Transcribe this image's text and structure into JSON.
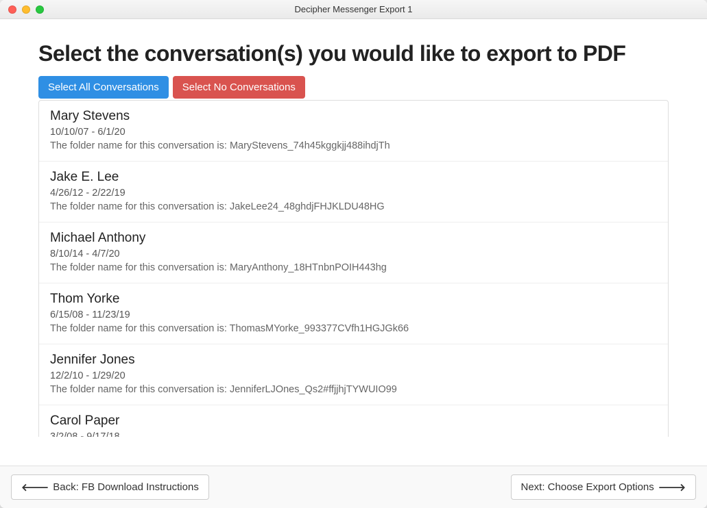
{
  "window": {
    "title": "Decipher Messenger Export 1"
  },
  "page": {
    "heading": "Select the conversation(s) you would like to export to PDF"
  },
  "buttons": {
    "select_all": "Select All Conversations",
    "select_none": "Select No Conversations"
  },
  "folder_label_prefix": "The folder name for this conversation is: ",
  "conversations": [
    {
      "name": "Mary Stevens",
      "dates": "10/10/07 - 6/1/20",
      "folder": "MaryStevens_74h45kggkjj488ihdjTh"
    },
    {
      "name": "Jake E. Lee",
      "dates": "4/26/12 - 2/22/19",
      "folder": "JakeLee24_48ghdjFHJKLDU48HG"
    },
    {
      "name": "Michael Anthony",
      "dates": "8/10/14 - 4/7/20",
      "folder": "MaryAnthony_18HTnbnPOIH443hg"
    },
    {
      "name": "Thom Yorke",
      "dates": "6/15/08 - 11/23/19",
      "folder": "ThomasMYorke_993377CVfh1HGJGk66"
    },
    {
      "name": "Jennifer Jones",
      "dates": "12/2/10 - 1/29/20",
      "folder": "JenniferLJOnes_Qs2#ffjjhjTYWUIO99"
    },
    {
      "name": "Carol Paper",
      "dates": "3/2/08 - 9/17/18",
      "folder": ""
    }
  ],
  "footer": {
    "back_label": "Back: FB Download Instructions",
    "next_label": "Next: Choose Export Options"
  }
}
